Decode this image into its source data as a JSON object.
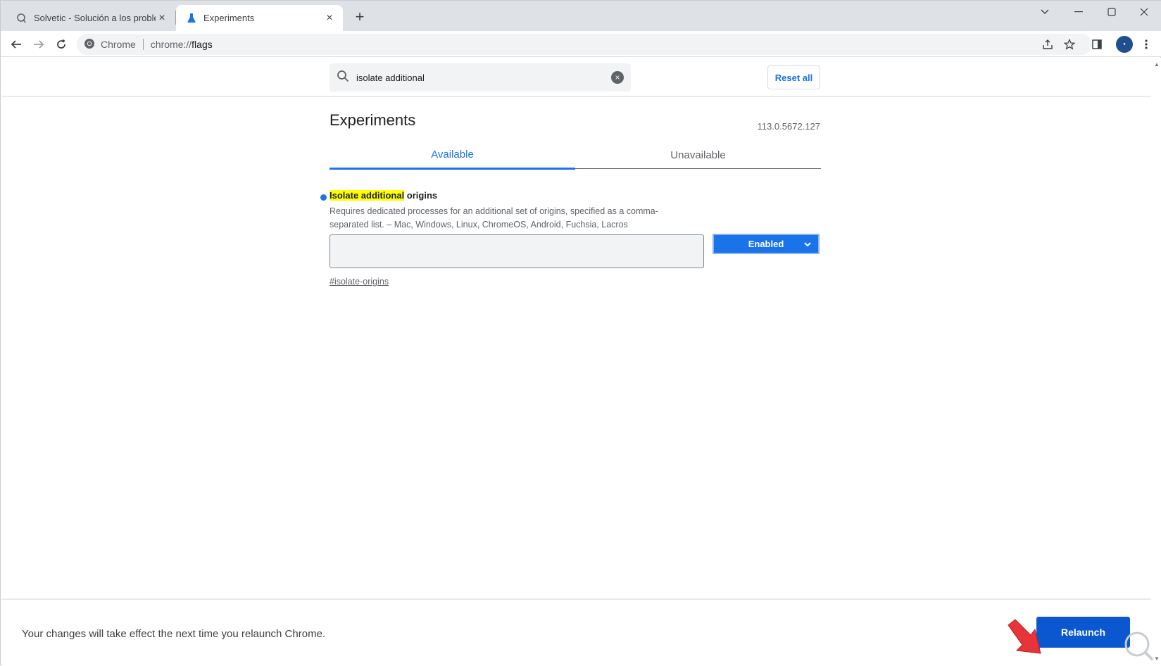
{
  "browser": {
    "tabs": [
      {
        "title": "Solvetic - Solución a los problem",
        "close": "×"
      },
      {
        "title": "Experiments",
        "close": "×"
      }
    ],
    "new_tab": "+",
    "omnibox": {
      "chip": "Chrome",
      "url_scheme": "chrome://",
      "url_path": "flags"
    }
  },
  "search": {
    "value": "isolate additional",
    "clear": "×",
    "reset_label": "Reset all"
  },
  "experiments": {
    "title": "Experiments",
    "version": "113.0.5672.127",
    "tabs": [
      {
        "label": "Available"
      },
      {
        "label": "Unavailable"
      }
    ]
  },
  "flag": {
    "name_highlight": "Isolate additional",
    "name_rest": " origins",
    "description": "Requires dedicated processes for an additional set of origins, specified as a comma-separated list. – Mac, Windows, Linux, ChromeOS, Android, Fuchsia, Lacros",
    "textarea_value": "",
    "selected": "Enabled",
    "link": "#isolate-origins"
  },
  "relaunch": {
    "message": "Your changes will take effect the next time you relaunch Chrome.",
    "button": "Relaunch"
  },
  "colors": {
    "accent": "#1a73e8",
    "relaunch": "#0b57d0",
    "highlight": "#ffff00",
    "arrow": "#e8333a"
  }
}
